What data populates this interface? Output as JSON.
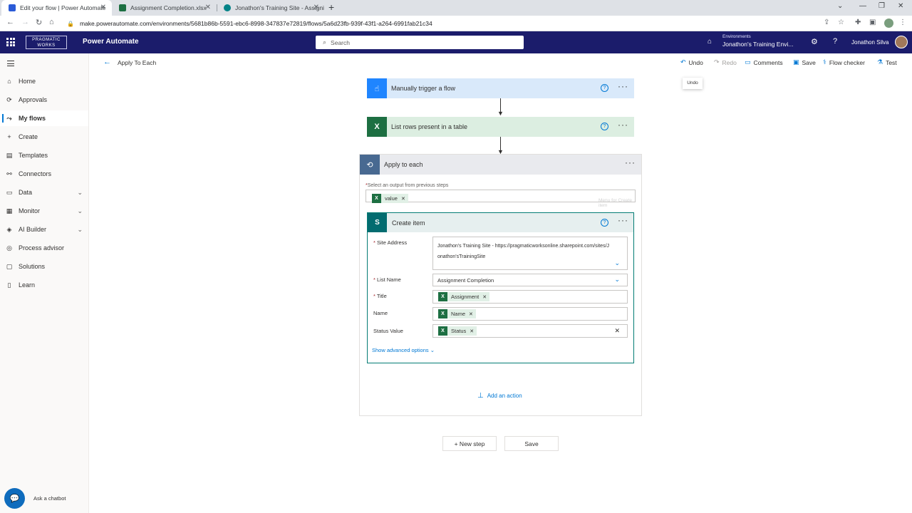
{
  "browser": {
    "tabs": [
      {
        "title": "Edit your flow | Power Automate",
        "active": true
      },
      {
        "title": "Assignment Completion.xlsx",
        "active": false
      },
      {
        "title": "Jonathon's Training Site - Assigni",
        "active": false
      }
    ],
    "url": "make.powerautomate.com/environments/5681b86b-5591-ebc6-8998-347837e72819/flows/5a6d23fb-939f-43f1-a264-6991fab21c34"
  },
  "header": {
    "logo_text": "PRAGMATIC WORKS",
    "app_name": "Power Automate",
    "search_placeholder": "Search",
    "env_label": "Environments",
    "env_name": "Jonathon's Training Envi...",
    "user_name": "Jonathon Silva"
  },
  "sidebar": {
    "items": [
      {
        "label": "Home",
        "icon": "home-icon"
      },
      {
        "label": "Approvals",
        "icon": "approvals-icon"
      },
      {
        "label": "My flows",
        "icon": "flows-icon",
        "active": true
      },
      {
        "label": "Create",
        "icon": "plus-icon"
      },
      {
        "label": "Templates",
        "icon": "templates-icon"
      },
      {
        "label": "Connectors",
        "icon": "connectors-icon"
      },
      {
        "label": "Data",
        "icon": "database-icon",
        "expandable": true
      },
      {
        "label": "Monitor",
        "icon": "monitor-icon",
        "expandable": true
      },
      {
        "label": "AI Builder",
        "icon": "ai-builder-icon",
        "expandable": true
      },
      {
        "label": "Process advisor",
        "icon": "process-advisor-icon"
      },
      {
        "label": "Solutions",
        "icon": "solutions-icon"
      },
      {
        "label": "Learn",
        "icon": "learn-icon"
      }
    ],
    "chatbot_label": "Ask a chatbot"
  },
  "commandbar": {
    "breadcrumb": "Apply To Each",
    "undo": "Undo",
    "redo": "Redo",
    "comments": "Comments",
    "save": "Save",
    "flow_checker": "Flow checker",
    "test": "Test",
    "tooltip": "Undo"
  },
  "flow": {
    "trigger": {
      "title": "Manually trigger a flow",
      "color": "#1f85ff"
    },
    "list_rows": {
      "title": "List rows present in a table",
      "color": "#1d6f42"
    },
    "apply_each": {
      "title": "Apply to each",
      "select_label": "Select an output from previous steps",
      "token": "value",
      "ghost_text": "Menu for Create item"
    },
    "create_item": {
      "title": "Create item",
      "fields": {
        "site_address_label": "Site Address",
        "site_address_value": "Jonathon's Training Site - https://pragmaticworksonline.sharepoint.com/sites/Jonathon'sTrainingSite",
        "list_name_label": "List Name",
        "list_name_value": "Assignment Completion",
        "title_label": "Title",
        "title_token": "Assignment",
        "name_label": "Name",
        "name_token": "Name",
        "status_label": "Status Value",
        "status_token": "Status"
      },
      "advanced": "Show advanced options"
    },
    "add_action": "Add an action"
  },
  "bottom": {
    "new_step": "+ New step",
    "save": "Save"
  },
  "colors": {
    "header_bg": "#1b1c6b",
    "accent": "#0078d4",
    "excel": "#1d6f42",
    "sharepoint": "#036c70"
  }
}
